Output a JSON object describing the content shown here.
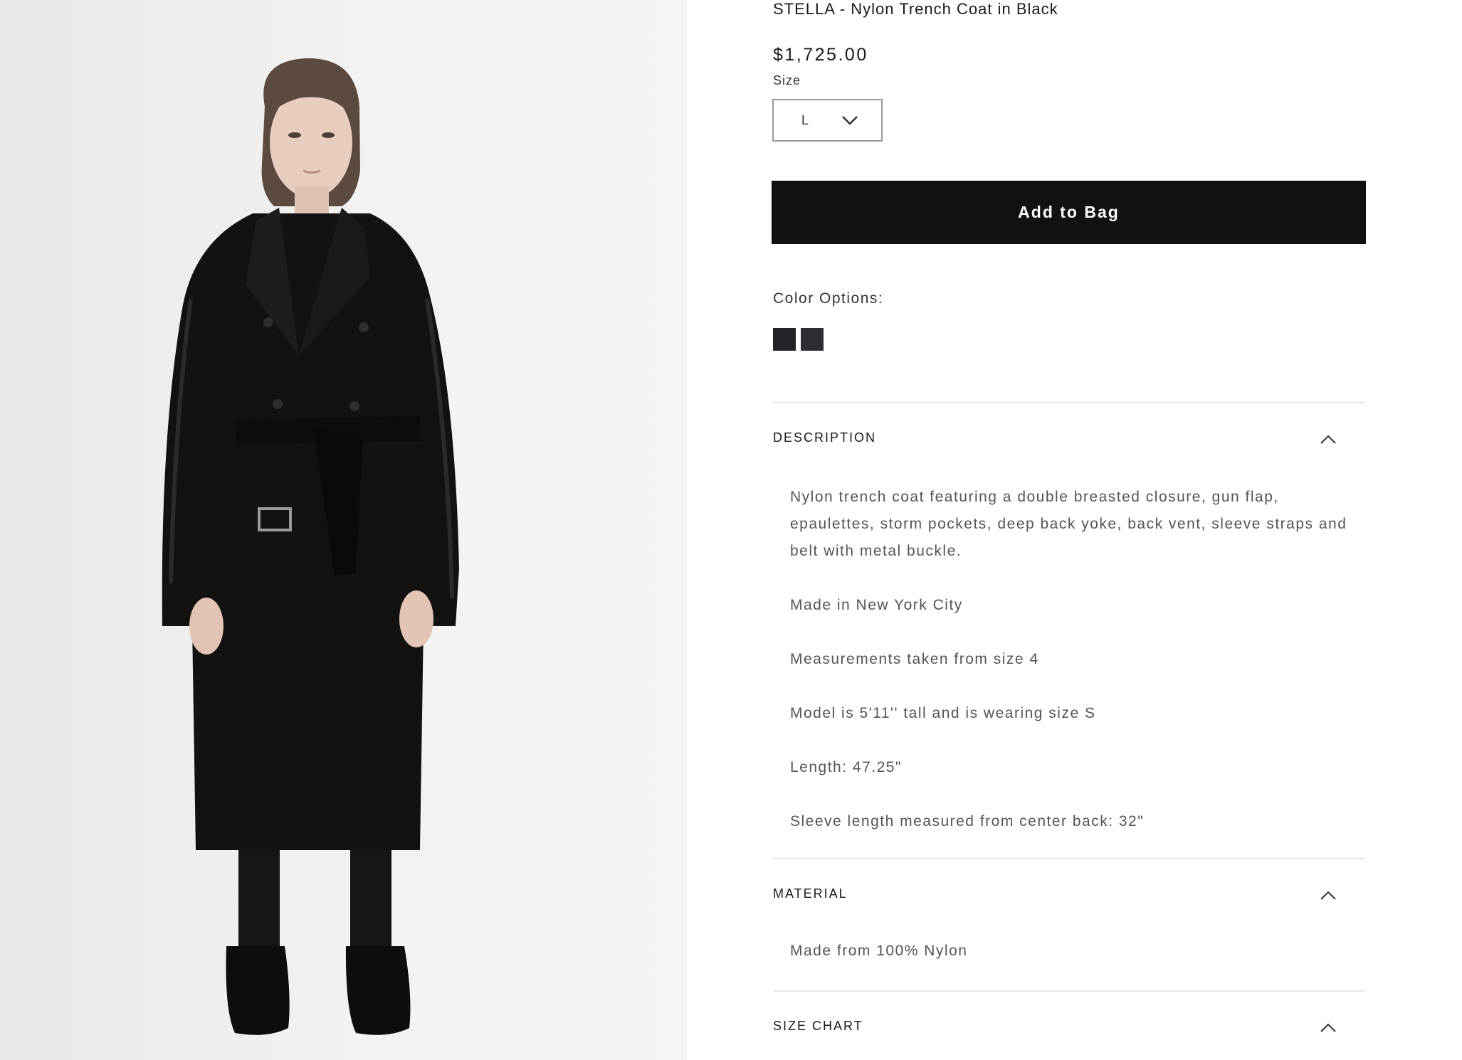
{
  "product": {
    "title": "STELLA - Nylon Trench Coat in Black",
    "price": "$1,725.00",
    "image_icon": "model-wearing-trench-coat-image"
  },
  "size": {
    "label": "Size",
    "selected": "L"
  },
  "actions": {
    "add_to_bag": "Add to Bag"
  },
  "colors": {
    "label": "Color Options:",
    "swatches": [
      "#23242a",
      "#2b2d33"
    ]
  },
  "accordion": {
    "description": {
      "title": "DESCRIPTION",
      "paragraphs": [
        "Nylon trench coat featuring a double breasted closure, gun flap, epaulettes, storm pockets, deep back yoke, back vent, sleeve straps and belt with metal buckle.",
        "Made in New York City",
        "Measurements taken from size 4",
        "Model is 5'11'' tall and is wearing size S",
        "Length: 47.25\"",
        "Sleeve length measured from center back: 32\""
      ]
    },
    "material": {
      "title": "MATERIAL",
      "paragraphs": [
        "Made from 100% Nylon"
      ]
    },
    "size_chart": {
      "title": "SIZE CHART"
    }
  },
  "theme": {
    "button_bg": "#111111",
    "text": "#1a1a1a",
    "body_text": "#555555",
    "divider": "#e6e6e6"
  }
}
